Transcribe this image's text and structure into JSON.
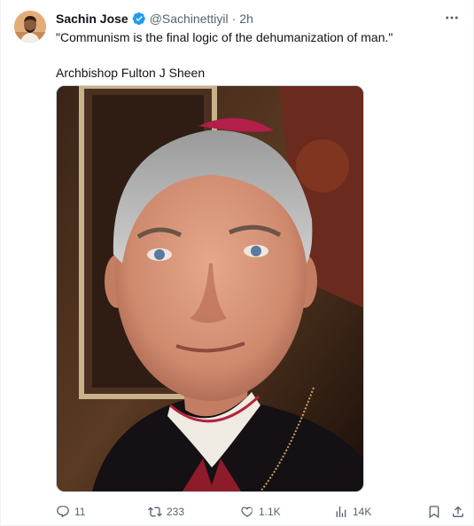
{
  "author": {
    "name": "Sachin Jose",
    "handle": "@Sachinettiyil",
    "separator": "·",
    "time": "2h",
    "verified": true,
    "verified_color": "#1d9bf0"
  },
  "tweet": {
    "line1": "\"Communism is the final logic of the dehumanization of man.\"",
    "line2": "Archbishop Fulton J Sheen"
  },
  "media": {
    "alt": "Portrait photograph of Archbishop Fulton J Sheen"
  },
  "actions": {
    "replies": "11",
    "retweets": "233",
    "likes": "1.1K",
    "views": "14K"
  },
  "icons": {
    "more": "more-horizontal-icon",
    "reply": "reply-icon",
    "retweet": "retweet-icon",
    "like": "heart-icon",
    "views": "views-chart-icon",
    "bookmark": "bookmark-icon",
    "share": "share-icon"
  },
  "colors": {
    "text_primary": "#0f1419",
    "text_secondary": "#536471",
    "accent": "#1d9bf0"
  }
}
